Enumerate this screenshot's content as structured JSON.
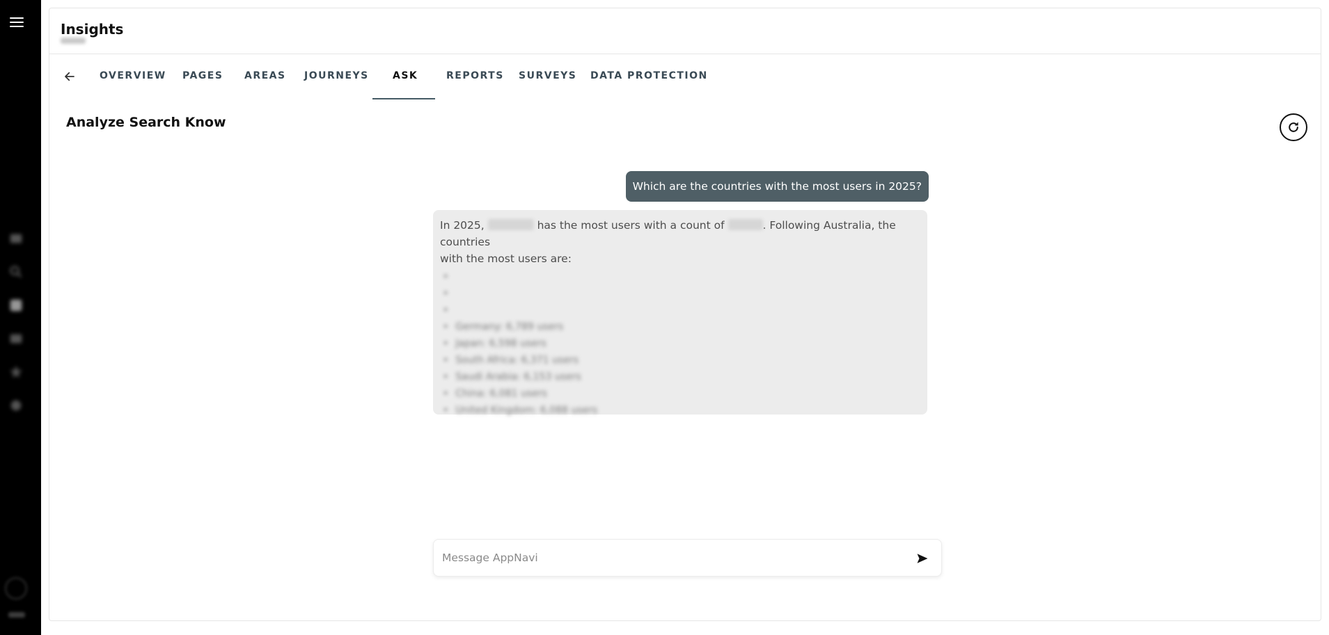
{
  "sidebar": {
    "menu_icon": "hamburger-icon",
    "icons": [
      "dashboard-icon",
      "search-icon",
      "insights-icon",
      "image-icon",
      "star-icon",
      "settings-icon"
    ]
  },
  "header": {
    "title": "Insights"
  },
  "tabs": {
    "items": [
      {
        "label": "OVERVIEW"
      },
      {
        "label": "PAGES"
      },
      {
        "label": "AREAS"
      },
      {
        "label": "JOURNEYS"
      },
      {
        "label": "ASK"
      },
      {
        "label": "REPORTS"
      },
      {
        "label": "SURVEYS"
      },
      {
        "label": "DATA PROTECTION"
      }
    ],
    "active": "ASK"
  },
  "page": {
    "title": "Analyze Search Know"
  },
  "chat": {
    "user_message": "Which are the countries with the most users in 2025?",
    "bot_message": {
      "part1": "In 2025,",
      "part2": "has the most users with a count of",
      "part3": ". Following Australia, the countries",
      "part4": "with the most users are:",
      "list": [
        "",
        "",
        "",
        "Germany: 6,789 users",
        "Japan: 6,598 users",
        "South Africa: 6,371 users",
        "Saudi Arabia: 6,153 users",
        "China: 6,081 users",
        "United Kingdom: 6,088 users"
      ]
    }
  },
  "composer": {
    "placeholder": "Message AppNavi"
  },
  "colors": {
    "sidebar_bg": "#000000",
    "user_bubble": "#4f5f66",
    "bot_bubble": "#ececec",
    "tab_underline": "#455a64"
  }
}
